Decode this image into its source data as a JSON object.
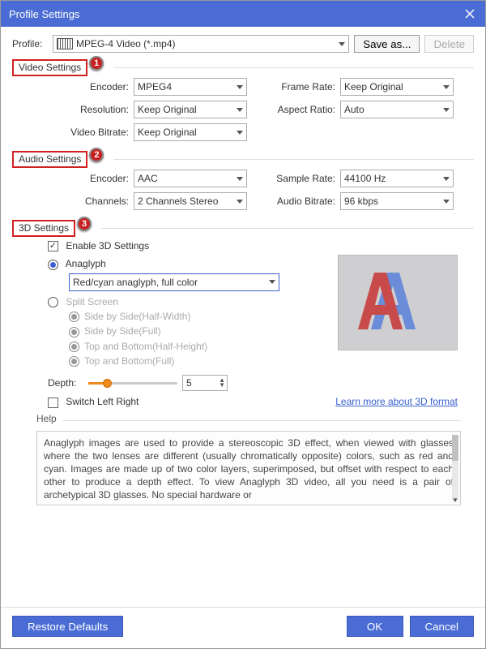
{
  "window": {
    "title": "Profile Settings"
  },
  "profile": {
    "label": "Profile:",
    "value": "MPEG-4 Video (*.mp4)",
    "saveAs": "Save as...",
    "delete": "Delete"
  },
  "sections": {
    "video": {
      "title": "Video Settings",
      "callout": "1",
      "encoder": {
        "label": "Encoder:",
        "value": "MPEG4"
      },
      "resolution": {
        "label": "Resolution:",
        "value": "Keep Original"
      },
      "videoBitrate": {
        "label": "Video Bitrate:",
        "value": "Keep Original"
      },
      "frameRate": {
        "label": "Frame Rate:",
        "value": "Keep Original"
      },
      "aspectRatio": {
        "label": "Aspect Ratio:",
        "value": "Auto"
      }
    },
    "audio": {
      "title": "Audio Settings",
      "callout": "2",
      "encoder": {
        "label": "Encoder:",
        "value": "AAC"
      },
      "channels": {
        "label": "Channels:",
        "value": "2 Channels Stereo"
      },
      "sampleRate": {
        "label": "Sample Rate:",
        "value": "44100 Hz"
      },
      "audioBitrate": {
        "label": "Audio Bitrate:",
        "value": "96 kbps"
      }
    },
    "threeD": {
      "title": "3D Settings",
      "callout": "3",
      "enable": "Enable 3D Settings",
      "anaglyph": "Anaglyph",
      "anaglyphMode": "Red/cyan anaglyph, full color",
      "split": "Split Screen",
      "sideHalf": "Side by Side(Half-Width)",
      "sideFull": "Side by Side(Full)",
      "topHalf": "Top and Bottom(Half-Height)",
      "topFull": "Top and Bottom(Full)",
      "depthLabel": "Depth:",
      "depthValue": "5",
      "switch": "Switch Left Right",
      "learnMore": "Learn more about 3D format"
    }
  },
  "help": {
    "title": "Help",
    "text": "Anaglyph images are used to provide a stereoscopic 3D effect, when viewed with glasses where the two lenses are different (usually chromatically opposite) colors, such as red and cyan. Images are made up of two color layers, superimposed, but offset with respect to each other to produce a depth effect. To view Anaglyph 3D video, all you need is a pair of archetypical 3D glasses. No special hardware or"
  },
  "footer": {
    "restore": "Restore Defaults",
    "ok": "OK",
    "cancel": "Cancel"
  }
}
